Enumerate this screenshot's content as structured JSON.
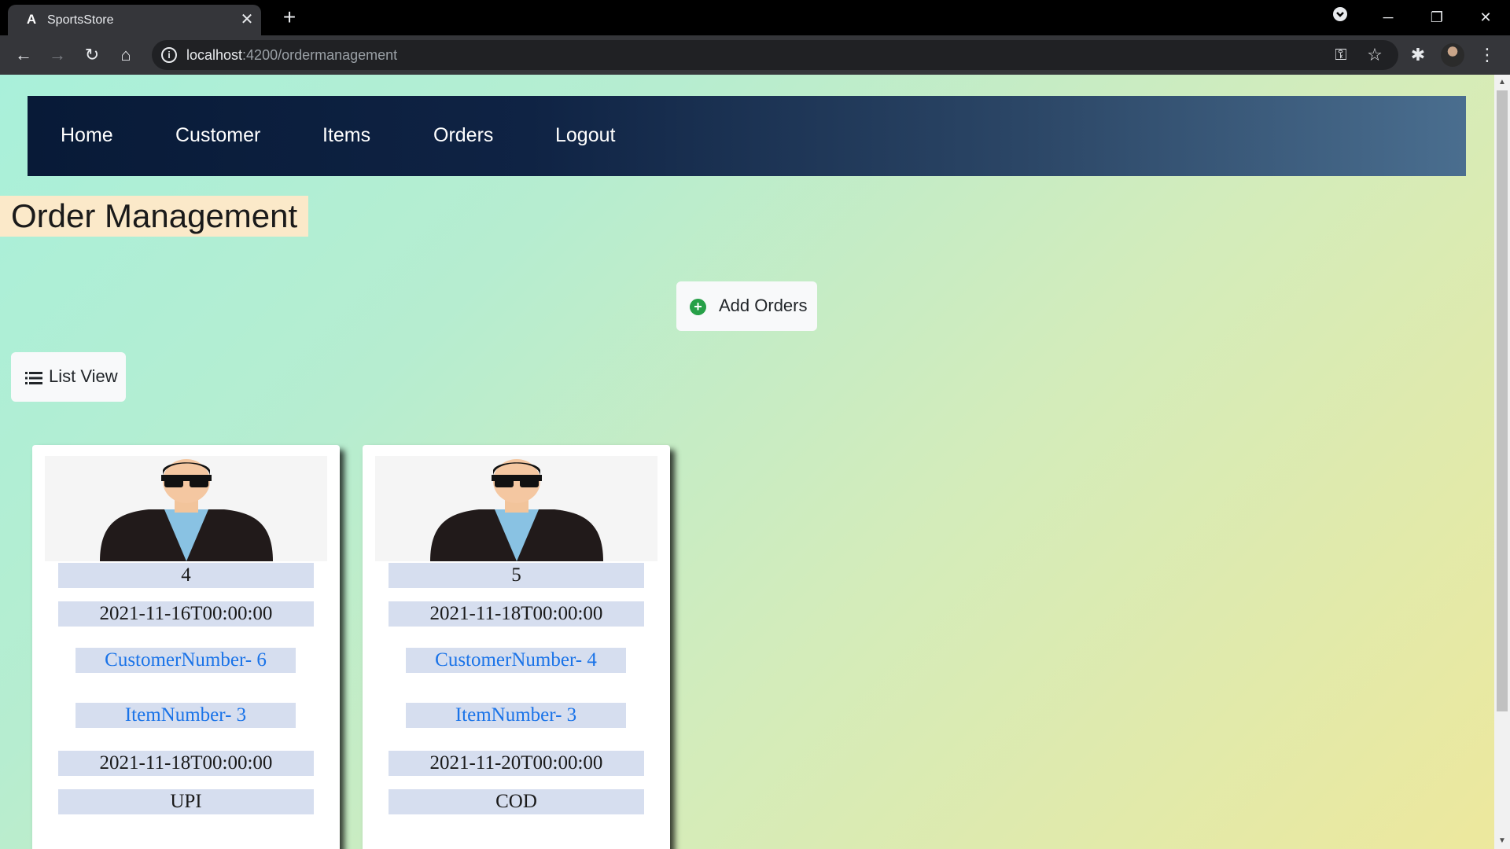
{
  "browser": {
    "tab_title": "SportsStore",
    "url_host": "localhost",
    "url_path": ":4200/ordermanagement"
  },
  "nav": {
    "items": [
      "Home",
      "Customer",
      "Items",
      "Orders",
      "Logout"
    ]
  },
  "page": {
    "title": "Order Management",
    "add_button": "Add Orders",
    "list_view_button": "List View"
  },
  "orders": [
    {
      "order_number": "4",
      "order_date": "2021-11-16T00:00:00",
      "customer": "CustomerNumber- 6",
      "item": "ItemNumber- 3",
      "delivery_date": "2021-11-18T00:00:00",
      "payment": "UPI"
    },
    {
      "order_number": "5",
      "order_date": "2021-11-18T00:00:00",
      "customer": "CustomerNumber- 4",
      "item": "ItemNumber- 3",
      "delivery_date": "2021-11-20T00:00:00",
      "payment": "COD"
    }
  ],
  "colors": {
    "nav_dark": "#081a37",
    "nav_light": "#4a6e8f",
    "title_bg": "#fbe9c9",
    "field_bg": "#d6deef",
    "link": "#1a73e8",
    "add_icon": "#27a048",
    "primary": "#0d6efd"
  },
  "icons": {
    "add": "plus-circle-icon",
    "list": "list-icon",
    "avatar": "person-avatar-icon"
  }
}
